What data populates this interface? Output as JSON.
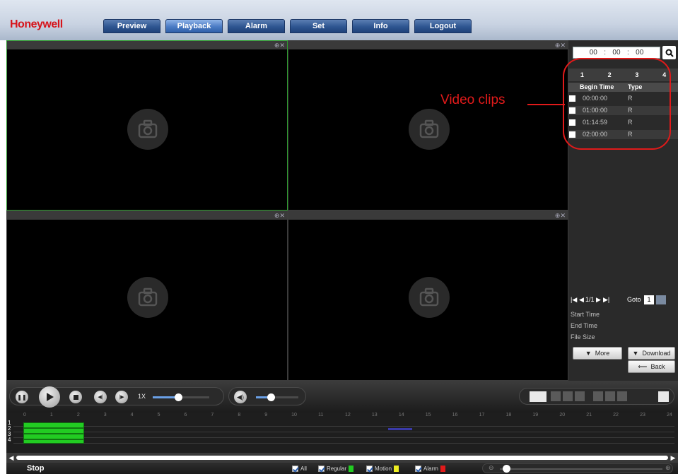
{
  "header": {
    "brand": "Honeywell",
    "tabs": [
      {
        "label": "Preview",
        "active": false
      },
      {
        "label": "Playback",
        "active": true
      },
      {
        "label": "Alarm",
        "active": false
      },
      {
        "label": "Set",
        "active": false
      },
      {
        "label": "Info",
        "active": false
      },
      {
        "label": "Logout",
        "active": false
      }
    ]
  },
  "panes": {
    "icon": "camera-icon",
    "controls": "⊕✕"
  },
  "right_panel": {
    "time": {
      "hh": "00",
      "mm": "00",
      "ss": "00",
      "sep": ":"
    },
    "search_icon": "search-icon",
    "channels": [
      "1",
      "2",
      "3",
      "4"
    ],
    "columns": {
      "begin_time": "Begin Time",
      "type": "Type"
    },
    "clips": [
      {
        "begin_time": "00:00:00",
        "type": "R"
      },
      {
        "begin_time": "01:00:00",
        "type": "R"
      },
      {
        "begin_time": "01:14:59",
        "type": "R"
      },
      {
        "begin_time": "02:00:00",
        "type": "R"
      }
    ],
    "pager": {
      "first": "|◀",
      "prev": "◀",
      "page": "1/1",
      "next": "▶",
      "last": "▶|",
      "goto_label": "Goto",
      "goto_value": "1"
    },
    "start_time_label": "Start Time",
    "end_time_label": "End Time",
    "file_size_label": "File Size",
    "more_label": "More",
    "download_label": "Download",
    "back_label": "Back"
  },
  "controls": {
    "speed_label": "1X",
    "speed_level": 0.45,
    "volume_level": 0.35
  },
  "timeline": {
    "hours": [
      "0",
      "1",
      "2",
      "3",
      "4",
      "5",
      "6",
      "7",
      "8",
      "9",
      "10",
      "11",
      "12",
      "13",
      "14",
      "15",
      "16",
      "17",
      "18",
      "19",
      "20",
      "21",
      "22",
      "23",
      "24"
    ],
    "rows": [
      "1",
      "2",
      "3",
      "4"
    ]
  },
  "status": {
    "state": "Stop",
    "legend": [
      {
        "label": "All",
        "color": null
      },
      {
        "label": "Regular",
        "color": "#22cc22"
      },
      {
        "label": "Motion",
        "color": "#eeee22"
      },
      {
        "label": "Alarm",
        "color": "#e11a1a"
      }
    ]
  },
  "annotation": {
    "label": "Video clips",
    "color": "#e11a1a"
  }
}
